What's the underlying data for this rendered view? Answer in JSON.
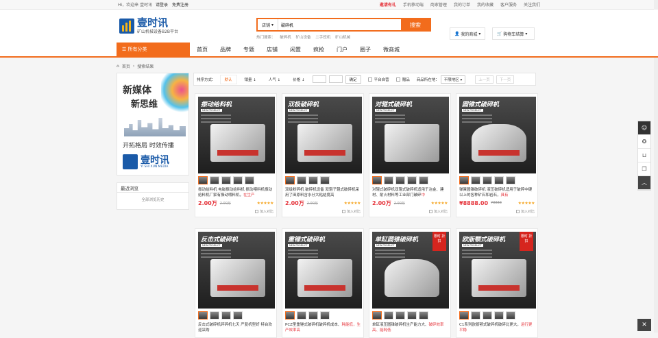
{
  "topbar": {
    "welcome": "Hi，欢迎来 壹时讯",
    "login": "请登录",
    "register": "免费注册",
    "links": [
      "邀请有礼",
      "手机移动端",
      "商家管理",
      "我的订单",
      "我的收藏",
      "客户服务",
      "关注我们"
    ]
  },
  "header": {
    "logo_name": "壹时讯",
    "logo_sub": "矿山机械设备B2B平台",
    "search_scope": "店铺",
    "search_value": "破碎机",
    "search_button": "搜索",
    "hot_label": "热门搜索：",
    "hot_words": [
      "破碎机",
      "矿山设备",
      "二手挖机",
      "矿山机械"
    ],
    "my_store": "我的商城",
    "cart": "购物车结算"
  },
  "nav": {
    "category": "所有分类",
    "items": [
      "首页",
      "品牌",
      "专题",
      "店铺",
      "闲置",
      "疯抢",
      "门户",
      "圈子",
      "微商城"
    ]
  },
  "breadcrumb": [
    "首页",
    "搜索结果"
  ],
  "sidebar": {
    "banner_line1": "新媒体",
    "banner_line2": "新思维",
    "banner_slogan": "开拓格局 时效传播",
    "banner_brand": "壹时讯",
    "banner_brand_en": "YI SHI XUN MEDIA",
    "recent_title": "最近浏览",
    "recent_clear": "全部浏览历史"
  },
  "filter": {
    "label": "排序方式：",
    "sorts": [
      "默认",
      "销量",
      "人气",
      "价格"
    ],
    "confirm": "确定",
    "self_run": "平台自营",
    "gift": "赠品",
    "location_label": "商品所在地：",
    "location_value": "不限地区",
    "prev": "上一页",
    "next": "下一页"
  },
  "products": [
    {
      "img_title": "振动给料机",
      "name_pre": "振动给料机 电磁振动给料机 振动喂料机振动给料机厂家有振动喂料机，",
      "name_hl": "在生产",
      "price": "2.00万",
      "old": "2.00万",
      "compare": "加入对比",
      "promo": false
    },
    {
      "img_title": "双极破碎机",
      "name_pre": "双级粉碎机 破碎机设备 双辊子辊式破碎机采用了田原料含水分大粘结度高",
      "name_hl": "",
      "price": "2.00万",
      "old": "2.00万",
      "compare": "加入对比",
      "promo": false
    },
    {
      "img_title": "对辊式破碎机",
      "name_pre": "对辊式破碎机双辊式破碎机适用于冶金、建材、耐火材料等工业部门破碎",
      "name_hl": "中",
      "price": "2.00万",
      "old": "2.00万",
      "compare": "加入对比",
      "promo": false
    },
    {
      "img_title": "圆锥式破碎机",
      "name_pre": "弹簧圆锥破碎机 液压破碎机适用于破碎中硬以上的各种矿石和岩石，",
      "name_hl": "具有",
      "price": "¥8888.00",
      "old": "¥8888",
      "compare": "加入对比",
      "promo": false
    },
    {
      "img_title": "反击式破碎机",
      "name_pre": "反击式破碎机碎碎机七天 严复机型好 特台欢迎采购",
      "name_hl": "",
      "price": "",
      "old": "",
      "compare": "",
      "promo": false
    },
    {
      "img_title": "重锤式破碎机",
      "name_pre": "PCZ型重锤式破碎机破碎机成本、",
      "name_hl": "耗能低，生产效率高",
      "price": "",
      "old": "",
      "compare": "",
      "promo": false
    },
    {
      "img_title": "单缸圆锥破碎机",
      "name_pre": "单缸液压圆锥破碎机生产能力大、",
      "name_hl": "破碎效率高、能耗低",
      "price": "",
      "old": "",
      "compare": "",
      "promo": true
    },
    {
      "img_title": "欧版颚式破碎机",
      "name_pre": "C1系列欧版颚式破碎机破碎比更大，",
      "name_hl": "运行更平稳",
      "price": "",
      "old": "",
      "compare": "",
      "promo": true
    }
  ],
  "promo_badge": "限时\n折扣",
  "product_tag": "NEW PRODUCT",
  "rating": "★★★★★",
  "rightbar": [
    "avatar",
    "star-icon",
    "cart-icon",
    "history-icon",
    "top-icon"
  ],
  "close": "✕"
}
